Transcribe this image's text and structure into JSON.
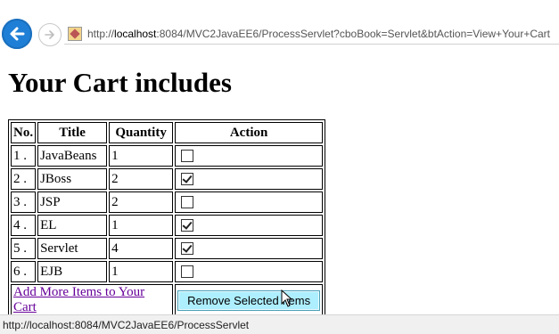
{
  "browser": {
    "url_prefix": "http://",
    "url_host": "localhost",
    "url_rest": ":8084/MVC2JavaEE6/ProcessServlet?cboBook=Servlet&btAction=View+Your+Cart"
  },
  "page": {
    "heading": "Your Cart includes"
  },
  "table": {
    "headers": [
      "No.",
      "Title",
      "Quantity",
      "Action"
    ],
    "rows": [
      {
        "no": "1 .",
        "title": "JavaBeans",
        "quantity": "1",
        "checked": false
      },
      {
        "no": "2 .",
        "title": "JBoss",
        "quantity": "2",
        "checked": true
      },
      {
        "no": "3 .",
        "title": "JSP",
        "quantity": "2",
        "checked": false
      },
      {
        "no": "4 .",
        "title": "EL",
        "quantity": "1",
        "checked": true
      },
      {
        "no": "5 .",
        "title": "Servlet",
        "quantity": "4",
        "checked": true
      },
      {
        "no": "6 .",
        "title": "EJB",
        "quantity": "1",
        "checked": false
      }
    ],
    "add_more_link": "Add More Items to Your Cart",
    "remove_button": "Remove Selected Items"
  },
  "statusbar": {
    "text": "http://localhost:8084/MVC2JavaEE6/ProcessServlet"
  }
}
